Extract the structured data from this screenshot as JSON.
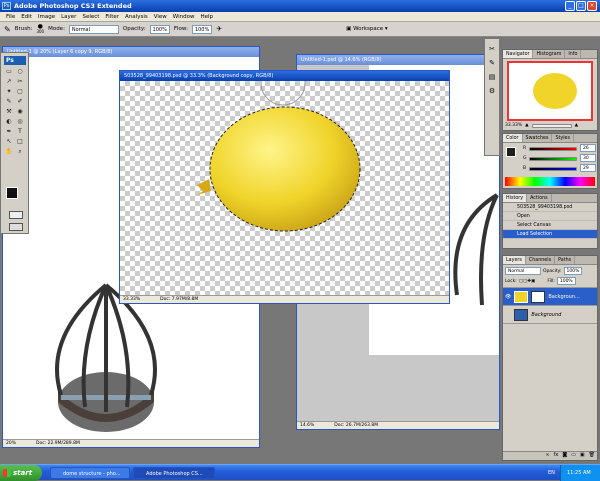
{
  "window": {
    "title": "Adobe Photoshop CS3 Extended",
    "app_icon": "Ps"
  },
  "menu": [
    "File",
    "Edit",
    "Image",
    "Layer",
    "Select",
    "Filter",
    "Analysis",
    "View",
    "Window",
    "Help"
  ],
  "options_bar": {
    "brush_label": "Brush:",
    "brush_size": "300",
    "mode_label": "Mode:",
    "mode_value": "Normal",
    "opacity_label": "Opacity:",
    "opacity_value": "100%",
    "flow_label": "Flow:",
    "flow_value": "100%",
    "workspace_label": "Workspace"
  },
  "documents": [
    {
      "title": "Untitled-1 @ 20% (Layer 6 copy 9, RGB/8)",
      "zoom": "20%",
      "doc_size": "Doc: 22.9M/289.8M"
    },
    {
      "title": "Untitled-1.psd @ 14.6% (RGB/8)",
      "zoom": "14.6%",
      "doc_size": "Doc: 26.7M/263.8M"
    },
    {
      "title": "503528_99403198.psd @ 33.3% (Background copy, RGB/8)",
      "zoom": "33.33%",
      "doc_size": "Doc: 7.97M/8.8M"
    }
  ],
  "toolbox": {
    "badge": "Ps",
    "tools": [
      "▭",
      "○",
      "↗",
      "✂",
      "✦",
      "▢",
      "✎",
      "✐",
      "⚒",
      "◉",
      "◐",
      "◎",
      "✒",
      "T",
      "↖",
      "□",
      "✋",
      "⌕"
    ]
  },
  "navigator": {
    "tabs": [
      "Navigator",
      "Histogram",
      "Info"
    ],
    "zoom": "33.33%"
  },
  "color": {
    "tabs": [
      "Color",
      "Swatches",
      "Styles"
    ],
    "r_label": "R",
    "r": "26",
    "g_label": "G",
    "g": "30",
    "b_label": "B",
    "b": "29",
    "fg_color": "#1a1e1d"
  },
  "history": {
    "tabs": [
      "History",
      "Actions"
    ],
    "snapshot": "503528_99403198.psd",
    "items": [
      "Open",
      "Select Canvas",
      "Load Selection"
    ]
  },
  "layers": {
    "tabs": [
      "Layers",
      "Channels",
      "Paths"
    ],
    "blend": "Normal",
    "opacity_label": "Opacity:",
    "opacity": "100%",
    "lock_label": "Lock:",
    "fill_label": "Fill:",
    "fill": "100%",
    "items": [
      "Backgroun...",
      "Background"
    ]
  },
  "taskbar": {
    "start": "start",
    "tasks": [
      "dome structure - pho...",
      "Adobe Photoshop CS..."
    ],
    "lang": "EN",
    "time": "11:25 AM"
  },
  "colors": {
    "titlebar": "#0a3fb0",
    "balloon": "#f0d42a",
    "selection": "#2a5ec9"
  }
}
